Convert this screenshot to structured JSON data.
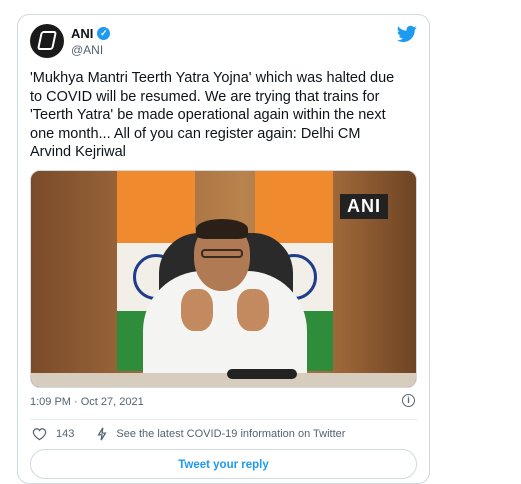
{
  "tweet": {
    "author_name": "ANI",
    "handle": "@ANI",
    "text": "'Mukhya Mantri Teerth Yatra Yojna' which was halted due\nto COVID will be resumed. We are trying that trains for\n'Teerth Yatra' be made operational again within the next\none month... All of you can register again: Delhi CM\nArvind Kejriwal",
    "media_watermark": "ANI",
    "timestamp": "1:09 PM · Oct 27, 2021",
    "like_count": "143",
    "covid_info": "See the latest COVID-19 information on Twitter",
    "reply_button": "Tweet your reply"
  },
  "icons": {
    "verified": "verified-badge-icon",
    "logo": "twitter-bird-icon",
    "info": "info-icon",
    "like": "heart-icon",
    "covid": "lightning-icon"
  },
  "colors": {
    "accent": "#1d9bf0",
    "text": "#0f1419",
    "muted": "#536471",
    "border": "#cfd9de"
  }
}
